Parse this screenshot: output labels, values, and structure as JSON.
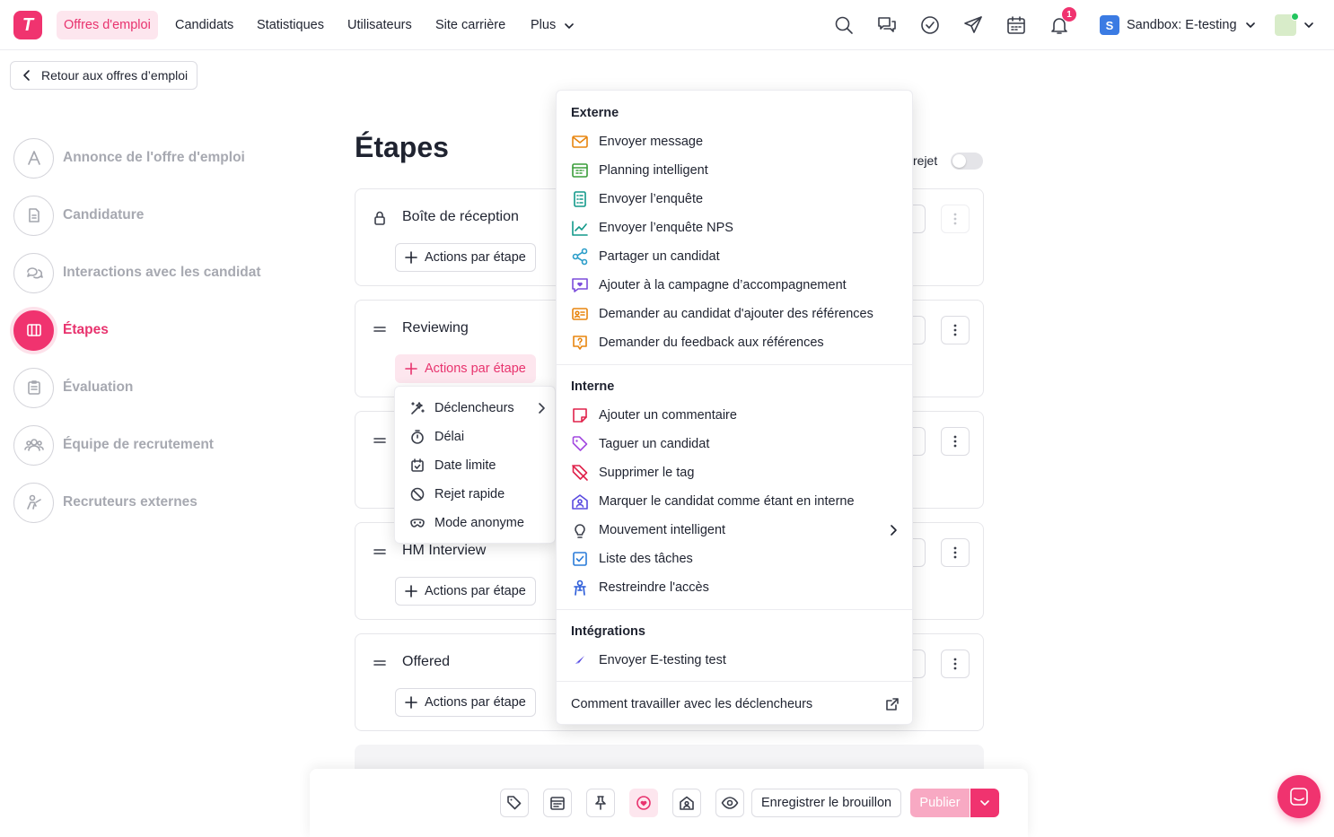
{
  "nav": {
    "logo": "T",
    "items": [
      "Offres d'emploi",
      "Candidats",
      "Statistiques",
      "Utilisateurs",
      "Site carrière",
      "Plus"
    ],
    "notif_count": "1",
    "workspace_initial": "S",
    "workspace": "Sandbox: E-testing"
  },
  "back_button": "Retour aux offres d’emploi",
  "sidebar": {
    "items": [
      {
        "label": "Annonce de l'offre d'emploi",
        "icon": "letter-a-icon"
      },
      {
        "label": "Candidature",
        "icon": "document-icon"
      },
      {
        "label": "Interactions avec les candidat",
        "icon": "chat-bubbles-icon"
      },
      {
        "label": "Étapes",
        "icon": "columns-icon",
        "active": true
      },
      {
        "label": "Évaluation",
        "icon": "clipboard-icon"
      },
      {
        "label": "Équipe de recrutement",
        "icon": "team-icon"
      },
      {
        "label": "Recruteurs externes",
        "icon": "recruiter-icon"
      }
    ]
  },
  "main": {
    "title": "Étapes",
    "reject_label": "rejet",
    "actions_label": "Actions par étape",
    "stages": [
      {
        "name": "Boîte de réception",
        "icon": "lock-icon"
      },
      {
        "name": "Reviewing",
        "icon": "drag-handle-icon"
      },
      {
        "name": "",
        "icon": "drag-handle-icon"
      },
      {
        "name": "HM Interview",
        "icon": "drag-handle-icon"
      },
      {
        "name": "Offered",
        "icon": "drag-handle-icon"
      }
    ]
  },
  "small_menu": {
    "items": [
      "Déclencheurs",
      "Délai",
      "Date limite",
      "Rejet rapide",
      "Mode anonyme"
    ]
  },
  "big_menu": {
    "external_title": "Externe",
    "external": [
      "Envoyer message",
      "Planning intelligent",
      "Envoyer l’enquête",
      "Envoyer l’enquête NPS",
      "Partager un candidat",
      "Ajouter à la campagne d’accompagnement",
      "Demander au candidat d'ajouter des références",
      "Demander du feedback aux références"
    ],
    "internal_title": "Interne",
    "internal": [
      "Ajouter un commentaire",
      "Taguer un candidat",
      "Supprimer le tag",
      "Marquer le candidat comme étant en interne",
      "Mouvement intelligent",
      "Liste des tâches",
      "Restreindre l'accès"
    ],
    "integrations_title": "Intégrations",
    "integrations": [
      "Envoyer E-testing test"
    ],
    "help_link": "Comment travailler avec les déclencheurs"
  },
  "bottom_bar": {
    "draft_label": "Enregistrer le brouillon",
    "publish_label": "Publier"
  },
  "colors": {
    "brand": "#f0336f",
    "orange": "#e8850f",
    "green": "#3a9d3a",
    "teal": "#12998a",
    "purple": "#7c4ddb",
    "red": "#e0224b",
    "blue": "#2a7bd9"
  }
}
